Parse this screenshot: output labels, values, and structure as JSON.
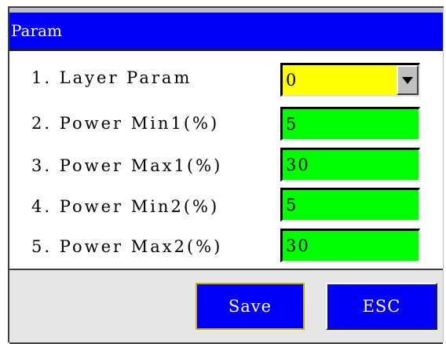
{
  "window": {
    "title": "Param"
  },
  "params": [
    {
      "label": "1. Layer Param",
      "value": "0",
      "type": "dropdown"
    },
    {
      "label": "2. Power Min1(%)",
      "value": "5",
      "type": "input"
    },
    {
      "label": "3. Power Max1(%)",
      "value": "30",
      "type": "input"
    },
    {
      "label": "4. Power Min2(%)",
      "value": "5",
      "type": "input"
    },
    {
      "label": "5. Power Max2(%)",
      "value": "30",
      "type": "input"
    }
  ],
  "buttons": {
    "save_label": "Save",
    "esc_label": "ESC"
  },
  "colors": {
    "titlebar": "#0000f6",
    "input_bg": "#00ff00",
    "dropdown_bg": "#ffff00",
    "button_bg": "#0000f6",
    "focus_border": "#c8b400"
  },
  "icons": {
    "dropdown": "chevron-down-icon"
  }
}
